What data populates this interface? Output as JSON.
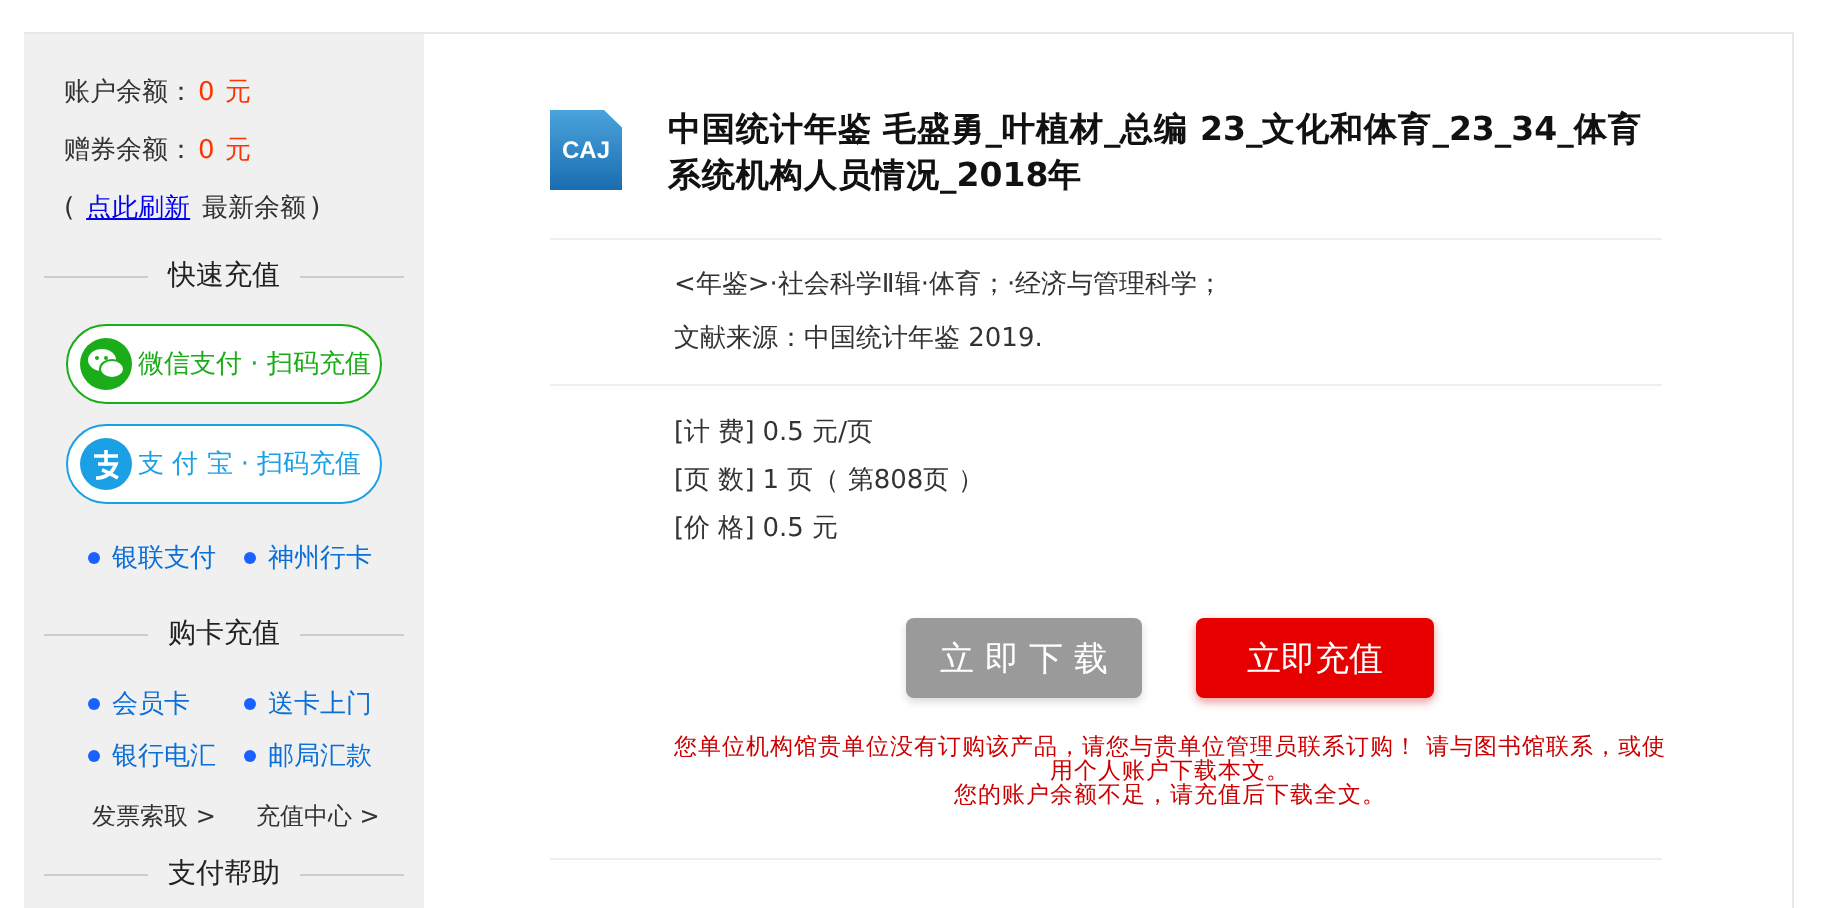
{
  "sidebar": {
    "balances": [
      {
        "label": "账户余额：",
        "amount": "0",
        "unit": "元"
      },
      {
        "label": "赠券余额：",
        "amount": "0",
        "unit": "元"
      }
    ],
    "refresh": {
      "open": "(",
      "link": "点此刷新",
      "text": "最新余额",
      "close": ")"
    },
    "quick_title": "快速充值",
    "pay_buttons": [
      {
        "kind": "wechat",
        "label": "微信支付 · 扫码充值"
      },
      {
        "kind": "alipay",
        "label": "支 付 宝 · 扫码充值"
      }
    ],
    "quick_links": [
      "银联支付",
      "神州行卡"
    ],
    "card_title": "购卡充值",
    "card_links": [
      "会员卡",
      "送卡上门",
      "银行电汇",
      "邮局汇款"
    ],
    "more_links": [
      "发票索取 >",
      "充值中心 >"
    ],
    "help_title": "支付帮助"
  },
  "document": {
    "file_type": "CAJ",
    "title": "中国统计年鉴 毛盛勇_叶植材_总编 23_文化和体育_23_34_体育系统机构人员情况_2018年",
    "category": "<年鉴>·社会科学Ⅱ辑·体育；·经济与管理科学；",
    "source": "文献来源：中国统计年鉴 2019.",
    "fees": [
      {
        "label": "[计 费]",
        "value": "0.5 元/页"
      },
      {
        "label": "[页 数]",
        "value": "1 页（ 第808页 ）"
      },
      {
        "label": "[价 格]",
        "value": "0.5 元"
      }
    ]
  },
  "actions": [
    {
      "label": "立 即 下 载",
      "disabled": true
    },
    {
      "label": "立即充值",
      "disabled": false
    }
  ],
  "notices": [
    "您单位机构馆贵单位没有订购该产品，请您与贵单位管理员联系订购！ 请与图书馆联系，或使用个人账户下载本文。",
    "您的账户余额不足，请充值后下载全文。"
  ]
}
